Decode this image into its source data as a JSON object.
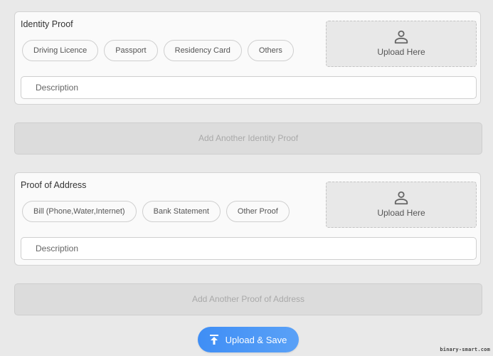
{
  "identity_section": {
    "title": "Identity Proof",
    "options": [
      "Driving Licence",
      "Passport",
      "Residency Card",
      "Others"
    ],
    "upload_label": "Upload Here",
    "description_placeholder": "Description",
    "add_another_label": "Add Another Identity Proof"
  },
  "address_section": {
    "title": "Proof of Address",
    "options": [
      "Bill (Phone,Water,Internet)",
      "Bank Statement",
      "Other Proof"
    ],
    "upload_label": "Upload Here",
    "description_placeholder": "Description",
    "add_another_label": "Add Another Proof of Address"
  },
  "save_button": {
    "label": "Upload & Save",
    "icon": "upload-arrow-icon"
  },
  "watermark": "binary-smart.com",
  "colors": {
    "accent": "#4a96f6",
    "page_background": "#e9e9e9",
    "card_background": "#fafafa",
    "disabled_text": "#a9a9a9"
  }
}
